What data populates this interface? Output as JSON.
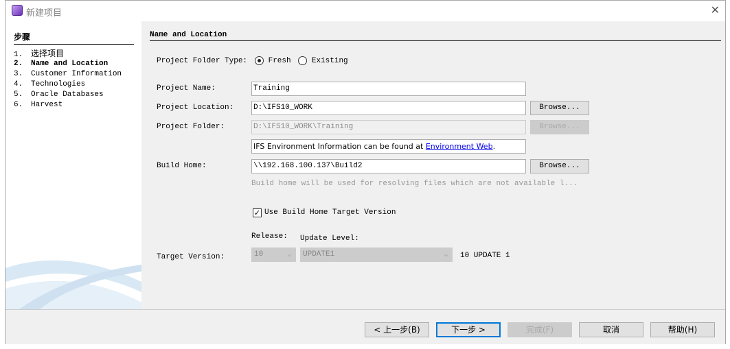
{
  "window": {
    "title": "新建项目"
  },
  "steps": {
    "header": "步骤",
    "items": [
      {
        "num": "1.",
        "label": "选择项目"
      },
      {
        "num": "2.",
        "label": "Name and Location"
      },
      {
        "num": "3.",
        "label": "Customer Information"
      },
      {
        "num": "4.",
        "label": "Technologies"
      },
      {
        "num": "5.",
        "label": "Oracle Databases"
      },
      {
        "num": "6.",
        "label": "Harvest"
      }
    ],
    "current": 1
  },
  "panel": {
    "title": "Name and Location",
    "folder_type_label": "Project Folder Type:",
    "fresh_label": "Fresh",
    "existing_label": "Existing",
    "selected": "Fresh",
    "project_name_label": "Project Name:",
    "project_name": "Training",
    "project_location_label": "Project Location:",
    "project_location": "D:\\IFS10_WORK",
    "project_folder_label": "Project Folder:",
    "project_folder": "D:\\IFS10_WORK\\Training",
    "browse_label": "Browse...",
    "env_info_text": "IFS Environment Information can be found at ",
    "env_link": "Environment Web",
    "env_tail": ".",
    "build_home_label": "Build Home:",
    "build_home": "\\\\192.168.100.137\\Build2",
    "build_home_hint": "Build home will be used for resolving files which are not available l...",
    "use_target_label": "Use Build Home Target Version",
    "use_target_checked": true,
    "release_label": "Release:",
    "update_level_label": "Update Level:",
    "target_version_label": "Target Version:",
    "release_value": "10",
    "update_level_value": "UPDATE1",
    "target_version_text": "10 UPDATE 1"
  },
  "footer": {
    "back": "< 上一步(B)",
    "next": "下一步 >",
    "finish": "完成(F)",
    "cancel": "取消",
    "help": "帮助(H)"
  }
}
